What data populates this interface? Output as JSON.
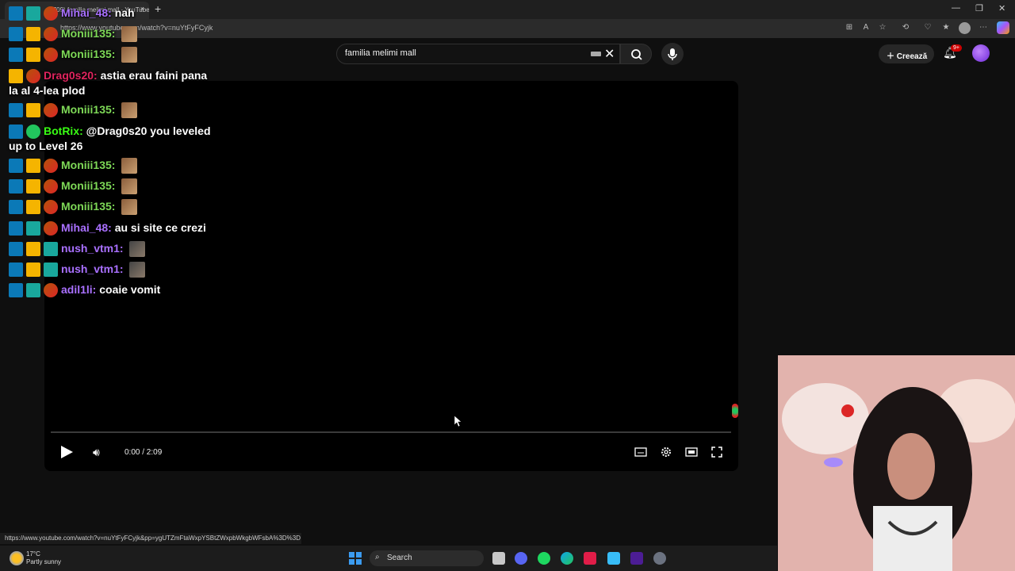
{
  "browser": {
    "tab_title": "(709) familia melimi mall - YouTube",
    "url": "https://www.youtube.com/watch?v=nuYtFyFCyjk",
    "new_tab_symbol": "+",
    "close_symbol": "×"
  },
  "youtube": {
    "search_value": "familia melimi mall",
    "create_label": "Creează",
    "notifications_badge": "9+"
  },
  "player": {
    "time": "0:00 / 2:09",
    "progress": 0
  },
  "chat": [
    {
      "user": "Mihai_48:",
      "message": "nah",
      "color": "#a970ff",
      "badges": [
        "mod",
        "sub",
        "mini"
      ],
      "emote": null
    },
    {
      "user": "Moniii135:",
      "message": "",
      "color": "#7ed957",
      "badges": [
        "mod",
        "crown",
        "mini"
      ],
      "emote": "a"
    },
    {
      "user": "Moniii135:",
      "message": "",
      "color": "#7ed957",
      "badges": [
        "mod",
        "crown",
        "mini"
      ],
      "emote": "a"
    },
    {
      "user": "Drag0s20:",
      "message": "astia erau faini pana",
      "message2": "la al 4-lea plod",
      "color": "#e0245e",
      "badges": [
        "crown",
        "mini"
      ],
      "emote": null
    },
    {
      "user": "Moniii135:",
      "message": "",
      "color": "#7ed957",
      "badges": [
        "mod",
        "crown",
        "mini"
      ],
      "emote": "a"
    },
    {
      "user": "BotRix:",
      "message": "@Drag0s20 you leveled",
      "message2": "up to Level 26",
      "color": "#39ff14",
      "badges": [
        "mod",
        "verified"
      ],
      "emote": null
    },
    {
      "user": "Moniii135:",
      "message": "",
      "color": "#7ed957",
      "badges": [
        "mod",
        "crown",
        "mini"
      ],
      "emote": "a"
    },
    {
      "user": "Moniii135:",
      "message": "",
      "color": "#7ed957",
      "badges": [
        "mod",
        "crown",
        "mini"
      ],
      "emote": "a"
    },
    {
      "user": "Moniii135:",
      "message": "",
      "color": "#7ed957",
      "badges": [
        "mod",
        "crown",
        "mini"
      ],
      "emote": "a"
    },
    {
      "user": "Mihai_48:",
      "message": "au si site ce crezi",
      "color": "#a970ff",
      "badges": [
        "mod",
        "sub",
        "mini"
      ],
      "emote": null
    },
    {
      "user": "nush_vtm1:",
      "message": "",
      "color": "#a970ff",
      "badges": [
        "mod",
        "crown",
        "sub"
      ],
      "emote": "b"
    },
    {
      "user": "nush_vtm1:",
      "message": "",
      "color": "#a970ff",
      "badges": [
        "mod",
        "crown",
        "sub"
      ],
      "emote": "b"
    },
    {
      "user": "adil1li:",
      "message": "coaie vomit",
      "color": "#a970ff",
      "badges": [
        "mod",
        "sub",
        "mini"
      ],
      "emote": null
    }
  ],
  "status_bar": {
    "hover_url": "https://www.youtube.com/watch?v=nuYtFyFCyjk&pp=ygUTZmFtaWxpYSBtZWxpbWkgbWFsbA%3D%3D"
  },
  "taskbar": {
    "temperature": "17°C",
    "weather": "Partly sunny",
    "search_label": "Search"
  },
  "colors": {
    "background": "#0f0f0f",
    "player": "#000000",
    "accent_red": "#cc0000"
  }
}
